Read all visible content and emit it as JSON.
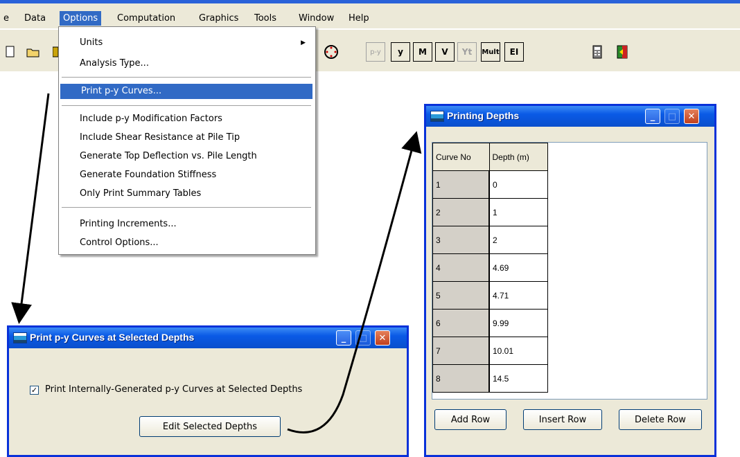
{
  "menubar": {
    "items": [
      "e",
      "Data",
      "Options",
      "Computation",
      "Graphics",
      "Tools",
      "Window",
      "Help"
    ]
  },
  "toolbar": {
    "buttons": [
      "p-y",
      "y",
      "M",
      "V",
      "Yt",
      "Mult",
      "EI"
    ]
  },
  "options_menu": {
    "items": [
      "Units",
      "Analysis Type...",
      "Print p-y Curves...",
      "Include p-y Modification Factors",
      "Include Shear Resistance at Pile Tip",
      "Generate Top Deflection vs. Pile Length",
      "Generate Foundation Stiffness",
      "Only Print Summary Tables",
      "Printing Increments...",
      "Control Options..."
    ]
  },
  "print_dialog": {
    "title": "Print p-y Curves at Selected Depths",
    "checkbox_label": "Print Internally-Generated p-y Curves at Selected Depths",
    "checkbox_checked": true,
    "edit_button": "Edit Selected Depths"
  },
  "depths_window": {
    "title": "Printing Depths",
    "columns": [
      "Curve No",
      "Depth (m)"
    ],
    "rows": [
      [
        "1",
        "0"
      ],
      [
        "2",
        "1"
      ],
      [
        "3",
        "2"
      ],
      [
        "4",
        "4.69"
      ],
      [
        "5",
        "4.71"
      ],
      [
        "6",
        "9.99"
      ],
      [
        "7",
        "10.01"
      ],
      [
        "8",
        "14.5"
      ]
    ],
    "buttons": [
      "Add Row",
      "Insert Row",
      "Delete Row"
    ]
  }
}
